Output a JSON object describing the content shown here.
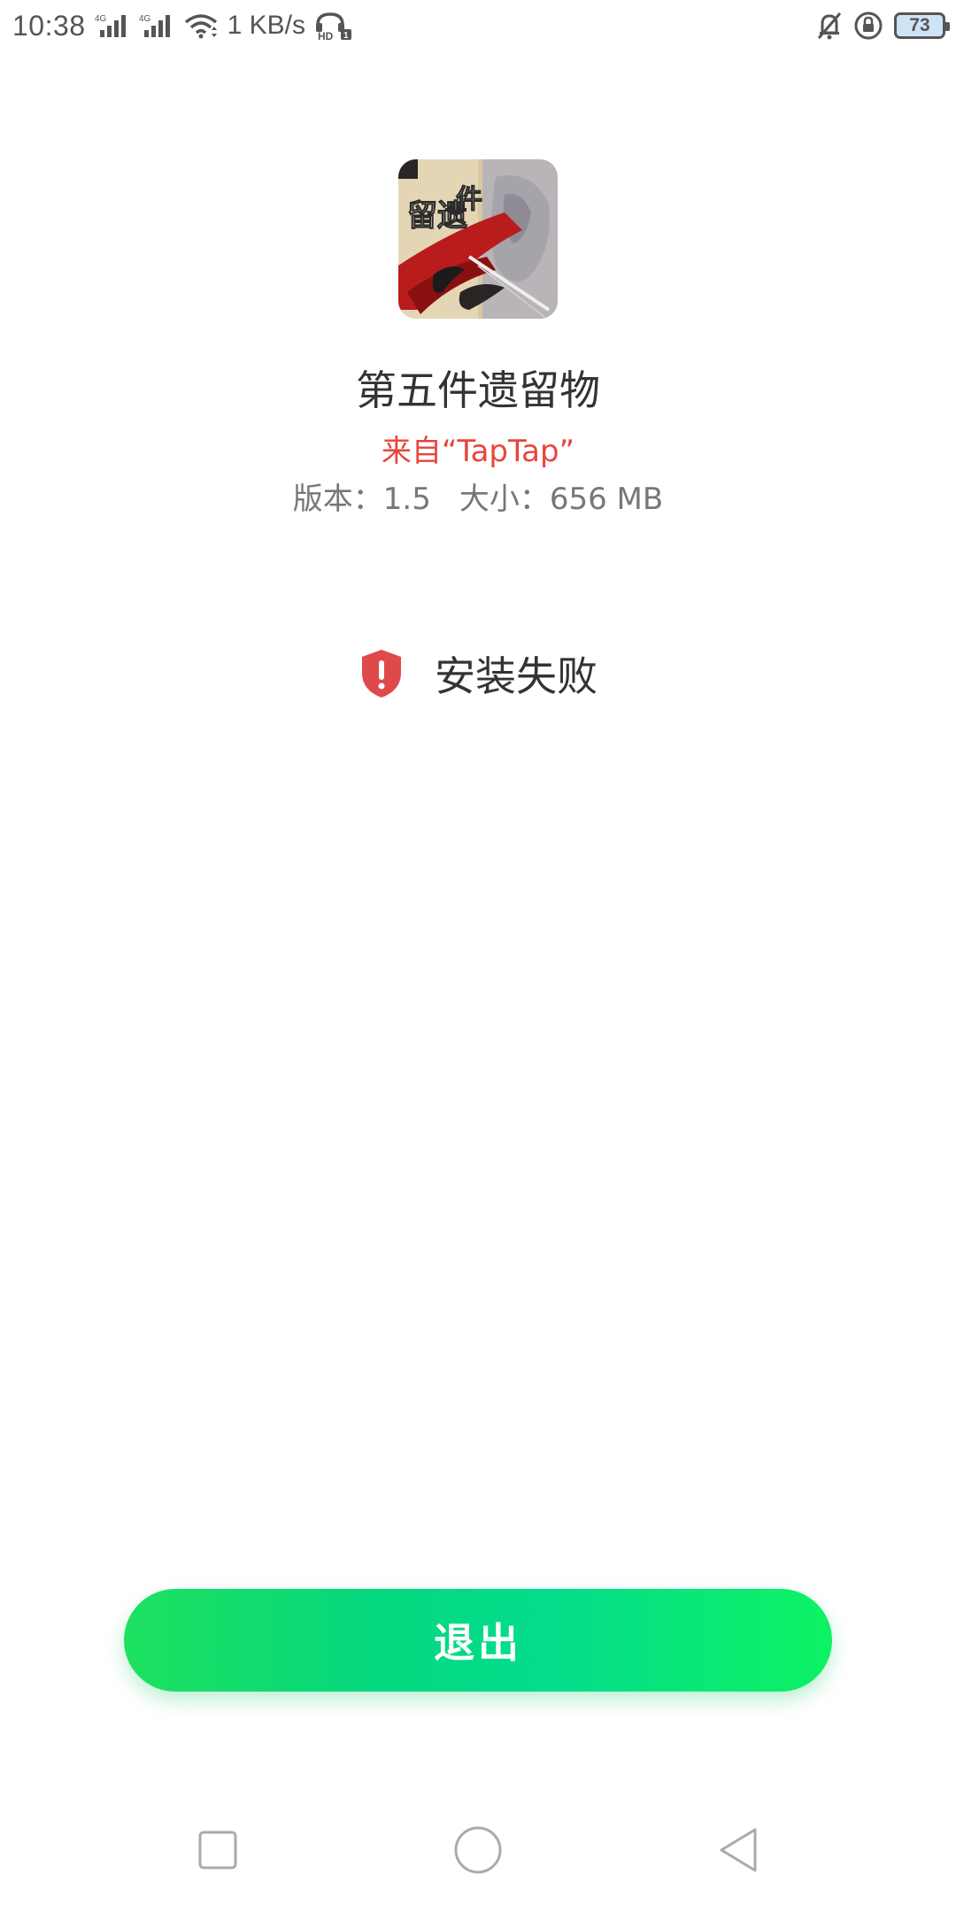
{
  "status_bar": {
    "time": "10:38",
    "network_speed": "1 KB/s",
    "battery": "73",
    "icons": [
      "signal-4g-icon",
      "signal-4g-icon",
      "wifi-icon",
      "hd-call-icon",
      "bell-muted-icon",
      "rotation-lock-icon",
      "battery-icon"
    ]
  },
  "app": {
    "name": "第五件遗留物",
    "source": "来自“TapTap”",
    "version": "版本：1.5",
    "size": "大小：656 MB",
    "icon": "app-game-artwork-icon"
  },
  "result": {
    "icon": "shield-alert-icon",
    "text": "安装失败",
    "icon_color": "#e0494a"
  },
  "actions": {
    "exit_label": "退出"
  },
  "nav": {
    "recents": "square-icon",
    "home": "circle-icon",
    "back": "triangle-back-icon"
  },
  "colors": {
    "source_text": "#e8453c",
    "button_start": "#1ee15f",
    "button_end": "#0df263"
  }
}
